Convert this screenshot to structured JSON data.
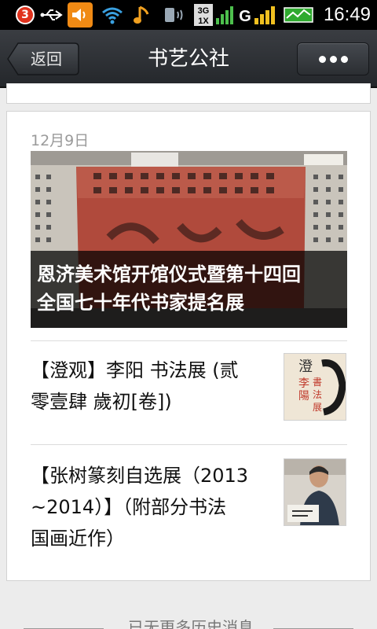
{
  "status_bar": {
    "notification_count": "3",
    "network": "3G",
    "network2": "1X",
    "carrier_letter": "G",
    "time": "16:49",
    "icons": [
      "notification-badge-icon",
      "usb-icon",
      "volume-icon",
      "wifi-icon",
      "music-icon",
      "vibrate-icon",
      "signal-3g-icon",
      "signal-g-icon",
      "battery-icon"
    ]
  },
  "header": {
    "back_label": "返回",
    "title": "书艺公社",
    "more_icon": "more-dots-icon"
  },
  "card": {
    "date": "12月9日",
    "hero": {
      "caption_line1": "恩济美术馆开馆仪式暨第十四回",
      "caption_line2": "全国七十年代书家提名展"
    },
    "articles": [
      {
        "title_line1": "【澄观】李阳 书法展 (贰",
        "title_line2": "零壹肆 歲初[卷])",
        "thumb_text": "澄觀 李陽書法展"
      },
      {
        "title_line1": "【张树篆刻自选展（2013",
        "title_line2": "~2014）】（附部分书法",
        "title_line3": "国画近作）"
      }
    ]
  },
  "footer": {
    "text": "已无更多历史消息"
  },
  "colors": {
    "accent_orange": "#f08a14",
    "badge_red": "#e0321d",
    "titlebar": "#2c2f33"
  }
}
